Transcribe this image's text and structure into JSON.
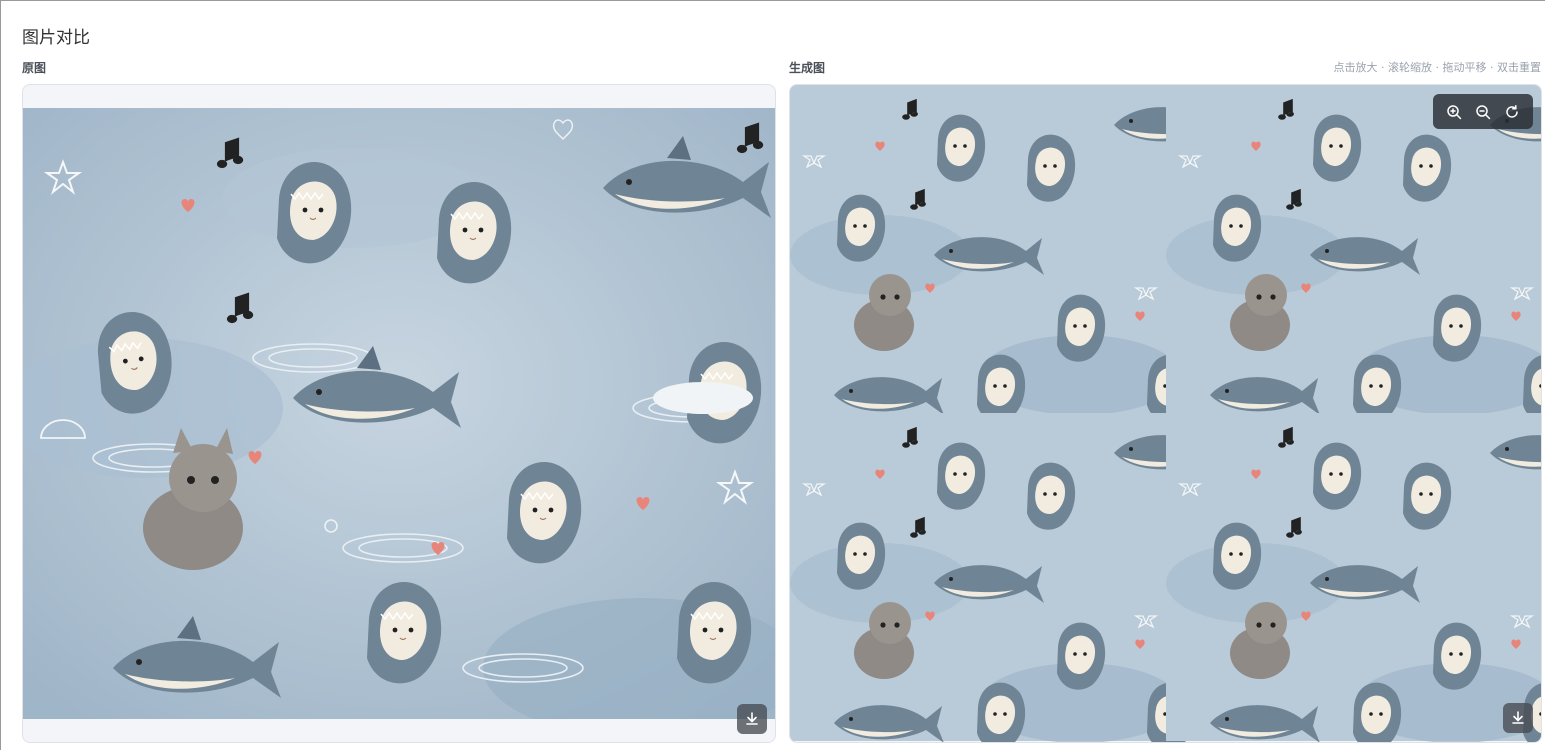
{
  "page": {
    "title": "图片对比",
    "original_label": "原图",
    "generated_label": "生成图",
    "hint": "点击放大 · 滚轮缩放 · 拖动平移 · 双击重置"
  },
  "icons": {
    "zoom_in": "zoom-in-icon",
    "zoom_out": "zoom-out-icon",
    "reset": "reset-icon",
    "download": "download-icon"
  },
  "colors": {
    "art_background": "#b9cad8",
    "shark": "#6f8596",
    "shark_dark": "#4d5d72",
    "belly": "#f2ece0",
    "heart": "#e8857a"
  }
}
